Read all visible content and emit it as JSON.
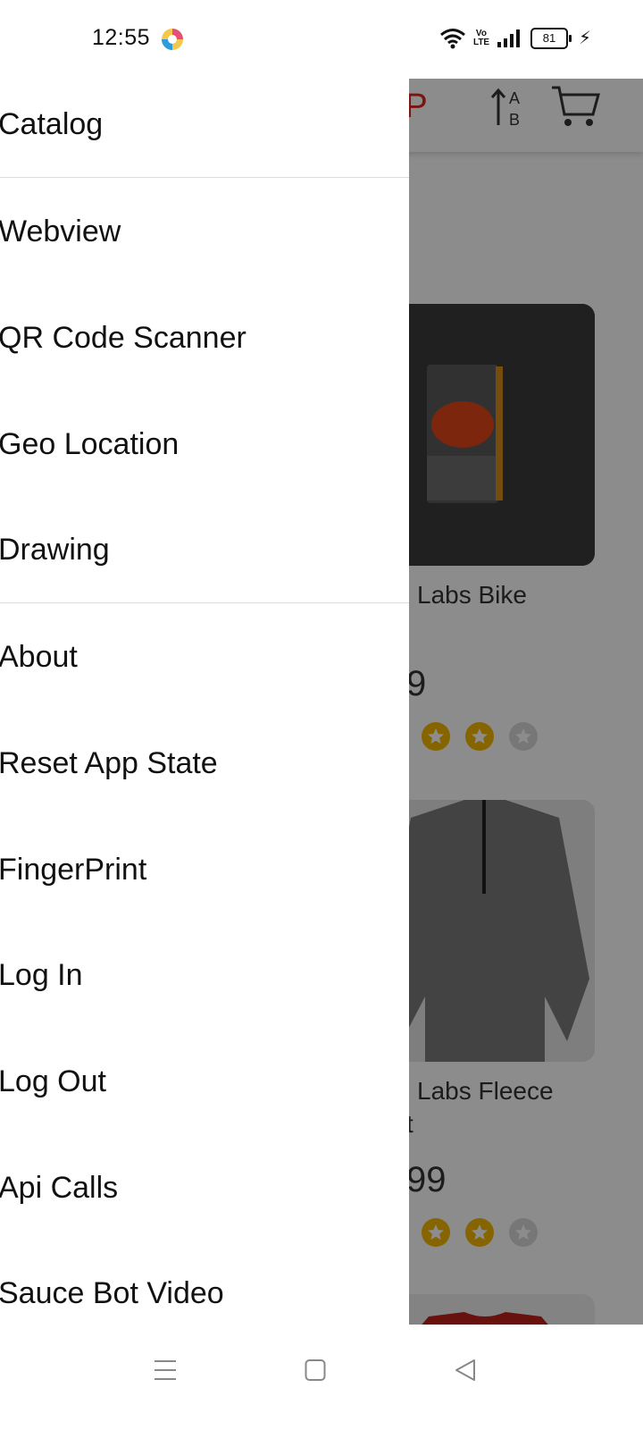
{
  "status_bar": {
    "time": "12:55",
    "volte": "Vo LTE",
    "battery": "81",
    "icons": [
      "app-notification-icon",
      "wifi-icon",
      "volte-icon",
      "signal-icon",
      "battery-icon",
      "charging-icon"
    ]
  },
  "background_app": {
    "title_fragment": "PP",
    "title_color": "#e2231a",
    "products": [
      {
        "name": "Labs Bike",
        "price": "9",
        "rating": 2,
        "max_rating": 3
      },
      {
        "name": "Labs Fleece",
        "name_line2": "t",
        "price": "99",
        "rating": 2,
        "max_rating": 3
      }
    ],
    "sort_icon_label_a": "A",
    "sort_icon_label_b": "B"
  },
  "drawer": {
    "items": [
      {
        "label": "Catalog"
      },
      {
        "label": "Webview"
      },
      {
        "label": "QR Code Scanner"
      },
      {
        "label": "Geo Location"
      },
      {
        "label": "Drawing"
      },
      {
        "label": "About"
      },
      {
        "label": "Reset App State"
      },
      {
        "label": "FingerPrint"
      },
      {
        "label": "Log In"
      },
      {
        "label": "Log Out"
      },
      {
        "label": "Api Calls"
      },
      {
        "label": "Sauce Bot Video"
      }
    ]
  },
  "nav_bar": {
    "icons": [
      "menu-icon",
      "home-icon",
      "back-icon"
    ]
  }
}
